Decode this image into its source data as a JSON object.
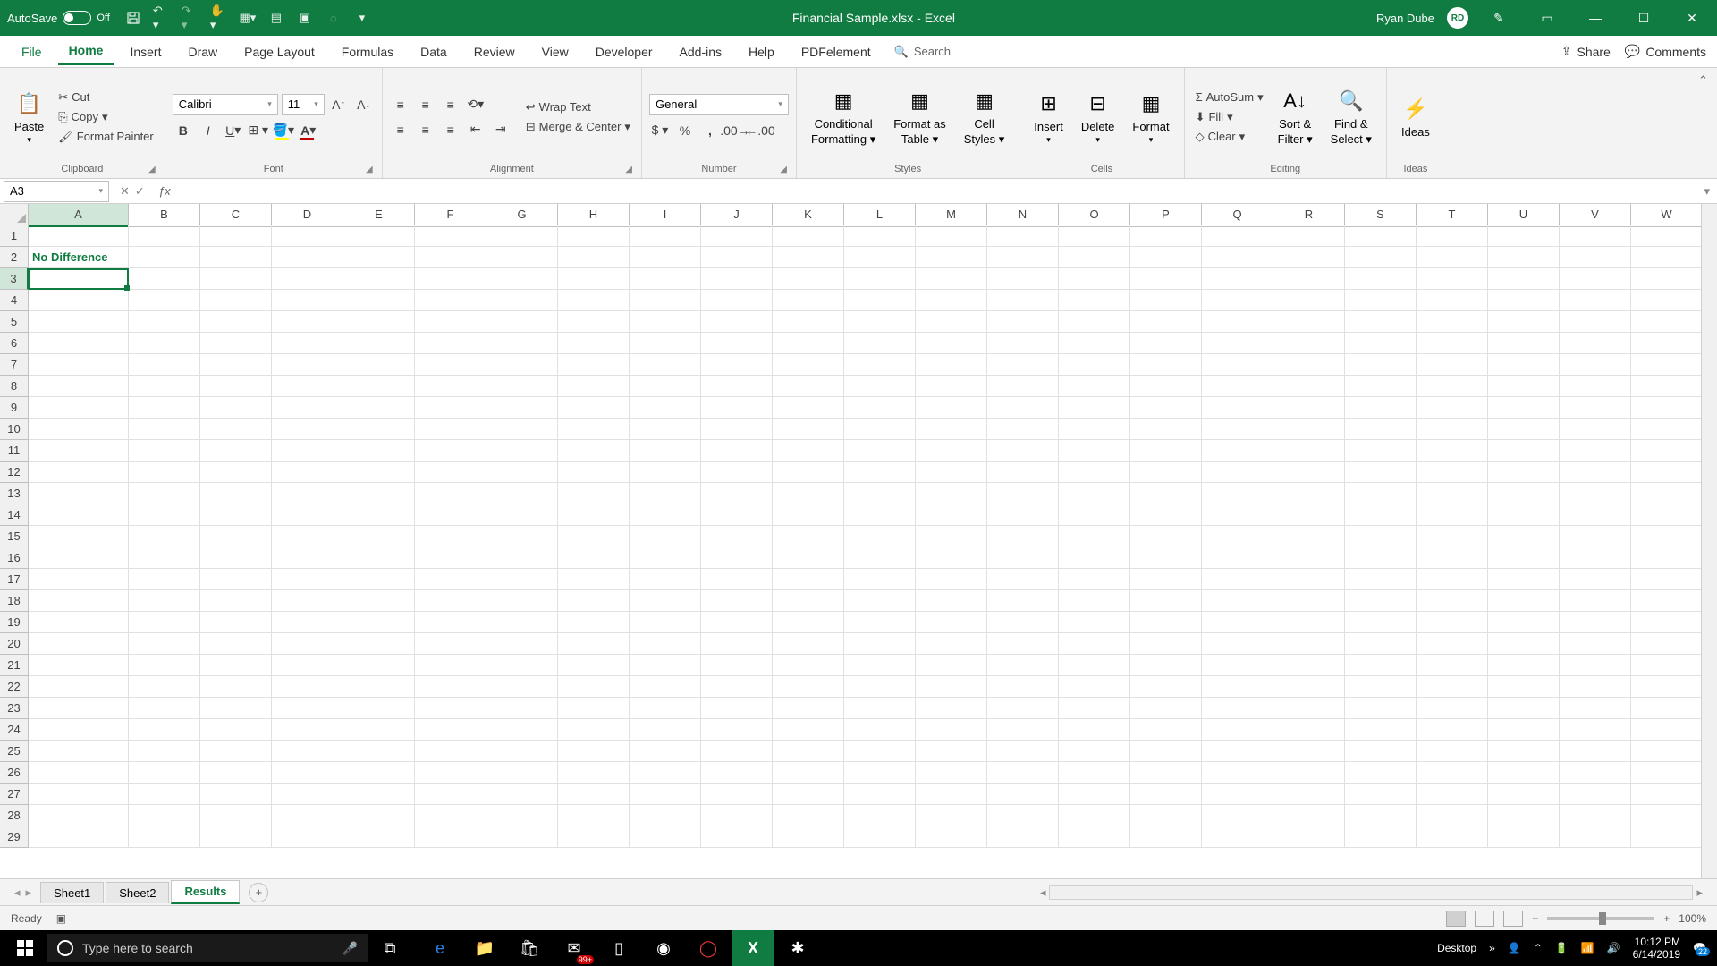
{
  "titlebar": {
    "autosave_label": "AutoSave",
    "autosave_state": "Off",
    "title": "Financial Sample.xlsx - Excel",
    "user": "Ryan Dube",
    "avatar_initials": "RD"
  },
  "tabs": {
    "items": [
      "File",
      "Home",
      "Insert",
      "Draw",
      "Page Layout",
      "Formulas",
      "Data",
      "Review",
      "View",
      "Developer",
      "Add-ins",
      "Help",
      "PDFelement"
    ],
    "active": "Home",
    "search_placeholder": "Search",
    "share": "Share",
    "comments": "Comments"
  },
  "ribbon": {
    "clipboard": {
      "paste": "Paste",
      "cut": "Cut",
      "copy": "Copy",
      "format_painter": "Format Painter",
      "label": "Clipboard"
    },
    "font": {
      "name": "Calibri",
      "size": "11",
      "label": "Font"
    },
    "alignment": {
      "wrap": "Wrap Text",
      "merge": "Merge & Center",
      "label": "Alignment"
    },
    "number": {
      "format": "General",
      "label": "Number"
    },
    "styles": {
      "cond1": "Conditional",
      "cond2": "Formatting",
      "fmt1": "Format as",
      "fmt2": "Table",
      "cell1": "Cell",
      "cell2": "Styles",
      "label": "Styles"
    },
    "cells": {
      "insert": "Insert",
      "delete": "Delete",
      "format": "Format",
      "label": "Cells"
    },
    "editing": {
      "autosum": "AutoSum",
      "fill": "Fill",
      "clear": "Clear",
      "sort1": "Sort &",
      "sort2": "Filter",
      "find1": "Find &",
      "find2": "Select",
      "label": "Editing"
    },
    "ideas": {
      "ideas": "Ideas",
      "label": "Ideas"
    }
  },
  "namebox": "A3",
  "grid": {
    "a2": "No Difference",
    "cols": [
      "A",
      "B",
      "C",
      "D",
      "E",
      "F",
      "G",
      "H",
      "I",
      "J",
      "K",
      "L",
      "M",
      "N",
      "O",
      "P",
      "Q",
      "R",
      "S",
      "T",
      "U",
      "V",
      "W"
    ]
  },
  "sheets": {
    "items": [
      "Sheet1",
      "Sheet2",
      "Results"
    ],
    "active": "Results"
  },
  "status": {
    "ready": "Ready",
    "zoom": "100%"
  },
  "taskbar": {
    "search_placeholder": "Type here to search",
    "desktop": "Desktop",
    "mail_badge": "99+",
    "time": "10:12 PM",
    "date": "6/14/2019",
    "notif_badge": "22"
  }
}
